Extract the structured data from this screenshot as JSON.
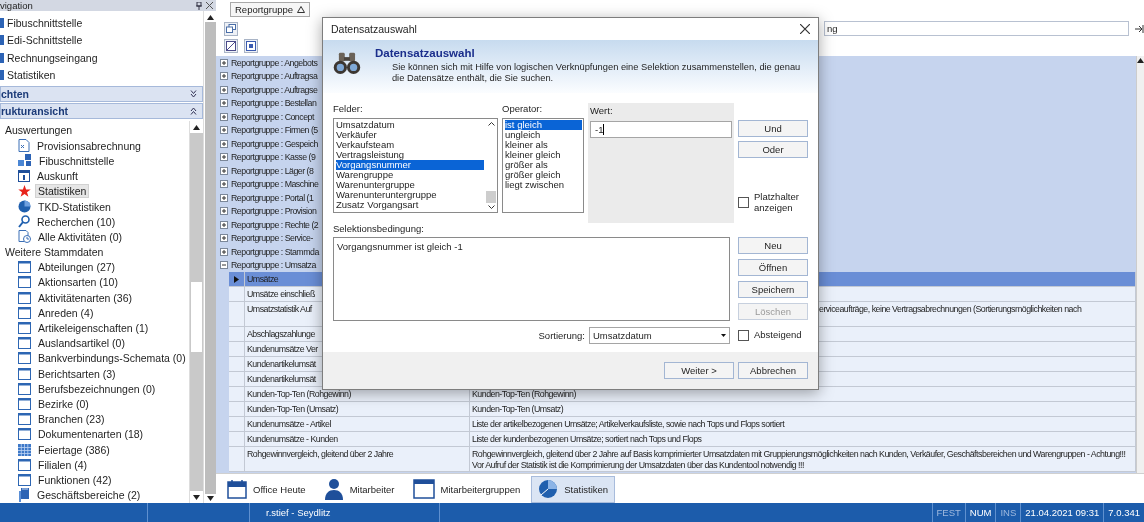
{
  "navigation": {
    "title": "vigation",
    "items": [
      {
        "label": "Fibuschnittstelle"
      },
      {
        "label": "Edi-Schnittstelle"
      },
      {
        "label": "Rechnungseingang"
      },
      {
        "label": "Statistiken"
      }
    ],
    "sections": [
      {
        "label": "chten",
        "expanded": false
      },
      {
        "label": "rukturansicht",
        "expanded": true
      }
    ],
    "tree": [
      {
        "label": "Auswertungen",
        "children": [
          {
            "label": "Provisionsabrechnung",
            "selected": false
          },
          {
            "label": "Fibuschnittstelle",
            "selected": false
          },
          {
            "label": "Auskunft",
            "selected": false
          },
          {
            "label": "Statistiken",
            "selected": true
          },
          {
            "label": "TKD-Statistiken",
            "selected": false
          },
          {
            "label": "Recherchen (10)",
            "selected": false
          },
          {
            "label": "Alle Aktivitäten (0)",
            "selected": false
          }
        ]
      },
      {
        "label": "Weitere Stammdaten",
        "children": [
          {
            "label": "Abteilungen (27)",
            "selected": false
          },
          {
            "label": "Aktionsarten (10)",
            "selected": false
          },
          {
            "label": "Aktivitätenarten (36)",
            "selected": false
          },
          {
            "label": "Anreden (4)",
            "selected": false
          },
          {
            "label": "Artikeleigenschaften (1)",
            "selected": false
          },
          {
            "label": "Auslandsartikel (0)",
            "selected": false
          },
          {
            "label": "Bankverbindungs-Schemata (0)",
            "selected": false
          },
          {
            "label": "Berichtsarten (3)",
            "selected": false
          },
          {
            "label": "Berufsbezeichnungen (0)",
            "selected": false
          },
          {
            "label": "Bezirke (0)",
            "selected": false
          },
          {
            "label": "Branchen (23)",
            "selected": false
          },
          {
            "label": "Dokumentenarten (18)",
            "selected": false
          },
          {
            "label": "Feiertage (386)",
            "selected": false
          },
          {
            "label": "Filialen (4)",
            "selected": false
          },
          {
            "label": "Funktionen (42)",
            "selected": false
          },
          {
            "label": "Geschäftsbereiche (2)",
            "selected": false
          }
        ]
      }
    ]
  },
  "report": {
    "group_by": "Reportgruppe",
    "column_header": "ng",
    "groups": [
      {
        "label": "Reportgruppe : Angebots",
        "expanded": false
      },
      {
        "label": "Reportgruppe : Auftragsa",
        "expanded": false
      },
      {
        "label": "Reportgruppe : Auftragse",
        "expanded": false
      },
      {
        "label": "Reportgruppe : Bestellan",
        "expanded": false
      },
      {
        "label": "Reportgruppe : Concept",
        "expanded": false
      },
      {
        "label": "Reportgruppe : Firmen (5",
        "expanded": false
      },
      {
        "label": "Reportgruppe : Gespeich",
        "expanded": false
      },
      {
        "label": "Reportgruppe : Kasse (9",
        "expanded": false
      },
      {
        "label": "Reportgruppe : Läger (8",
        "expanded": false
      },
      {
        "label": "Reportgruppe : Maschine",
        "expanded": false
      },
      {
        "label": "Reportgruppe : Portal (1",
        "expanded": false
      },
      {
        "label": "Reportgruppe : Provision",
        "expanded": false
      },
      {
        "label": "Reportgruppe : Rechte (2",
        "expanded": false
      },
      {
        "label": "Reportgruppe : Service-",
        "expanded": false
      },
      {
        "label": "Reportgruppe : Stammda",
        "expanded": false
      },
      {
        "label": "Reportgruppe : Umsatza",
        "expanded": true
      }
    ],
    "rows": [
      {
        "name": "Umsätze",
        "selected": true
      },
      {
        "name": "Umsätze einschließ",
        "selected": false
      },
      {
        "name": "Umsatzstatistik Auf",
        "description": "erviceaufträge, keine Vertragsabrechnungen (Sortierungsmöglichkeiten nach",
        "description_cut_by_dialog": true,
        "selected": false
      },
      {
        "name": "Abschlagszahlunge",
        "selected": false
      },
      {
        "name": "Kundenumsätze Ver",
        "selected": false
      },
      {
        "name": "Kundenartikelumsät",
        "selected": false
      },
      {
        "name": "Kundenartikelumsät",
        "selected": false
      },
      {
        "name": "Kunden-Top-Ten (Rohgewinn)",
        "description": "Kunden-Top-Ten (Rohgewinn)",
        "selected": false
      },
      {
        "name": "Kunden-Top-Ten (Umsatz)",
        "description": "Kunden-Top-Ten (Umsatz)",
        "selected": false
      },
      {
        "name": "Kundenumsätze - Artikel",
        "description": "Liste der artikelbezogenen Umsätze; Artikelverkaufsliste, sowie nach Tops und Flops sortiert",
        "selected": false
      },
      {
        "name": "Kundenumsätze - Kunden",
        "description": "Liste der kundenbezogenen Umsätze; sortiert nach Tops und Flops",
        "selected": false
      },
      {
        "name": "Rohgewinnvergleich, gleitend über 2 Jahre",
        "description": "Rohgewinnvergleich, gleitend über 2 Jahre auf Basis komprimierter Umsatzdaten mit Gruppierungsmöglichkeiten nach Kunden, Verkäufer, Geschäftsbereichen und Warengruppen  - Achtung!!! Vor Aufruf der Statistik ist die Komprimierung der Umsatzdaten über das Kundentool notwendig !!!",
        "selected": false
      }
    ]
  },
  "dialog": {
    "title": "Datensatzauswahl",
    "heading": "Datensatzauswahl",
    "description": "Sie können sich mit Hilfe von logischen Verknüpfungen eine Selektion zusammenstellen, die genau die Datensätze enthält, die Sie suchen.",
    "fields_label": "Felder:",
    "fields": [
      {
        "label": "Umsatzdatum",
        "selected": false
      },
      {
        "label": "Verkäufer",
        "selected": false
      },
      {
        "label": "Verkaufsteam",
        "selected": false
      },
      {
        "label": "Vertragsleistung",
        "selected": false
      },
      {
        "label": "Vorgangsnummer",
        "selected": true
      },
      {
        "label": "Warengruppe",
        "selected": false
      },
      {
        "label": "Warenuntergruppe",
        "selected": false
      },
      {
        "label": "Warenunteruntergruppe",
        "selected": false
      },
      {
        "label": "Zusatz Vorgangsart",
        "selected": false
      }
    ],
    "operator_label": "Operator:",
    "operators": [
      {
        "label": "ist gleich",
        "selected": true
      },
      {
        "label": "ungleich",
        "selected": false
      },
      {
        "label": "kleiner als",
        "selected": false
      },
      {
        "label": "kleiner gleich",
        "selected": false
      },
      {
        "label": "größer als",
        "selected": false
      },
      {
        "label": "größer gleich",
        "selected": false
      },
      {
        "label": "liegt zwischen",
        "selected": false
      }
    ],
    "value_label": "Wert:",
    "value": "-1",
    "logic_buttons": [
      {
        "label": "Und"
      },
      {
        "label": "Oder"
      }
    ],
    "placeholder_option": {
      "label": "Platzhalter anzeigen",
      "checked": false
    },
    "condition_label": "Selektionsbedingung:",
    "condition": "Vorgangsnummer ist gleich -1",
    "condition_buttons": [
      {
        "label": "Neu",
        "disabled": false
      },
      {
        "label": "Öffnen",
        "disabled": false
      },
      {
        "label": "Speichern",
        "disabled": false
      },
      {
        "label": "Löschen",
        "disabled": true
      }
    ],
    "sort_label": "Sortierung:",
    "sort_value": "Umsatzdatum",
    "descending_option": {
      "label": "Absteigend",
      "checked": false
    },
    "footer_buttons": [
      {
        "label": "Weiter >"
      },
      {
        "label": "Abbrechen"
      }
    ]
  },
  "tabs": [
    {
      "label": "Office Heute",
      "selected": false
    },
    {
      "label": "Mitarbeiter",
      "selected": false
    },
    {
      "label": "Mitarbeitergruppen",
      "selected": false
    },
    {
      "label": "Statistiken",
      "selected": true
    }
  ],
  "status_bar": {
    "user": "r.stief - Seydlitz",
    "indicators": [
      {
        "label": "FEST",
        "on": false
      },
      {
        "label": "NUM",
        "on": true
      },
      {
        "label": "INS",
        "on": false
      }
    ],
    "datetime": "21.04.2021 09:31",
    "version": "7.0.341"
  }
}
